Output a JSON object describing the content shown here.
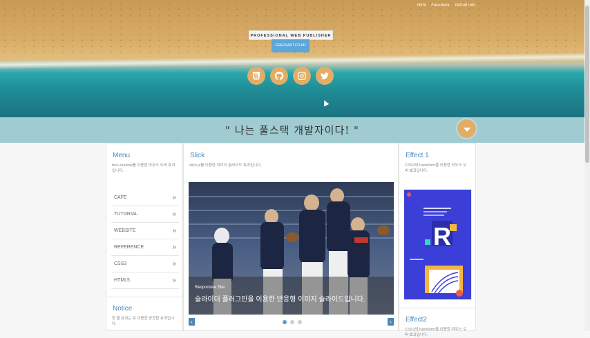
{
  "nav": {
    "links": [
      "Html",
      "Facebook",
      "Github Info"
    ]
  },
  "hero": {
    "publisher": "PROFESSIONAL WEB PUBLISHER",
    "link": "GREENART.CO.KR",
    "socials": [
      "html5-icon",
      "github-icon",
      "instagram-icon",
      "twitter-icon"
    ],
    "accent": "#e4ad66"
  },
  "band": {
    "quote": "\" 나는 풀스택 개발자이다! \"",
    "color": "#9fcbd1"
  },
  "menu": {
    "title": "Menu",
    "desc": "box-shadow를 이용한 마우스 오버 효과입니다.",
    "items": [
      {
        "label": "CAFE"
      },
      {
        "label": "TUTORIAL"
      },
      {
        "label": "WEBSITE"
      },
      {
        "label": "REFERENCE"
      },
      {
        "label": "CSS3"
      },
      {
        "label": "HTML5"
      }
    ],
    "arrow": "»"
  },
  "notice": {
    "title": "Notice",
    "desc": "한 줄 효과는 효 이용한 공정합 효과입니다."
  },
  "slick": {
    "title": "Slick",
    "desc": "slick.js를 이용한 이미지 슬라이드 효과입니다.",
    "caption_small": "Responsive Site",
    "caption_big": "슬라이더 플러그인을 이용한 반응형 이미지 슬라이드입니다.",
    "prev": "‹",
    "next": "›",
    "dots": 3,
    "active_dot": 0
  },
  "effect1": {
    "title": "Effect 1",
    "desc": "CSS3의 transform을 이용한 마우스 오버 효과입니다."
  },
  "effect2": {
    "title": "Effect2",
    "desc": "CSS3의 transform을 이용한 마우스 오버 효과입니다."
  }
}
